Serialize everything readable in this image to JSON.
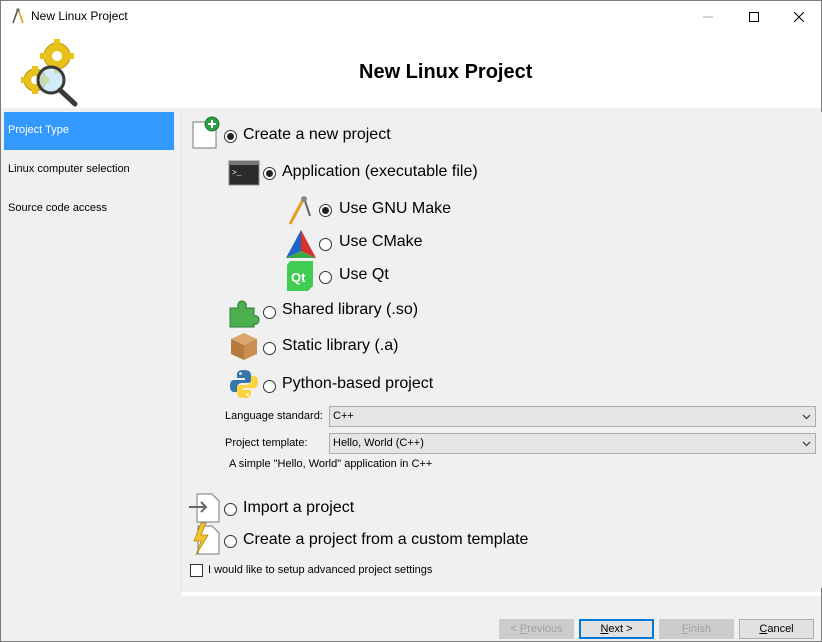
{
  "window": {
    "title": "New Linux Project",
    "controls": {
      "minimize": "minimize",
      "maximize": "maximize",
      "close": "close"
    }
  },
  "header": {
    "heading": "New Linux Project"
  },
  "sidebar": {
    "items": [
      {
        "label": "Project Type",
        "active": true
      },
      {
        "label": "Linux computer selection",
        "active": false
      },
      {
        "label": "Source code access",
        "active": false
      }
    ]
  },
  "options": {
    "create_new": {
      "label": "Create a new project",
      "checked": true
    },
    "application": {
      "label": "Application (executable file)",
      "checked": true
    },
    "gnu_make": {
      "label": "Use GNU Make",
      "checked": true
    },
    "cmake": {
      "label": "Use CMake",
      "checked": false
    },
    "qt": {
      "label": "Use Qt",
      "checked": false
    },
    "shared_library": {
      "label": "Shared library (.so)",
      "checked": false
    },
    "static_library": {
      "label": "Static library (.a)",
      "checked": false
    },
    "python": {
      "label": "Python-based project",
      "checked": false
    },
    "import": {
      "label": "Import a project",
      "checked": false
    },
    "custom_template": {
      "label": "Create a project from a custom template",
      "checked": false
    }
  },
  "fields": {
    "language_standard": {
      "label": "Language standard:",
      "value": "C++"
    },
    "project_template": {
      "label": "Project template:",
      "value": "Hello, World (C++)"
    },
    "template_hint": "A simple \"Hello, World\" application in C++"
  },
  "advanced_settings": {
    "label": "I would like to setup advanced project settings",
    "checked": false
  },
  "buttons": {
    "previous": {
      "prefix": "< ",
      "underline": "P",
      "rest": "revious",
      "enabled": false
    },
    "next": {
      "underline": "N",
      "rest": "ext >",
      "enabled": true
    },
    "finish": {
      "underline": "F",
      "rest": "inish",
      "enabled": false
    },
    "cancel": {
      "underline": "C",
      "rest": "ancel",
      "enabled": true
    }
  },
  "colors": {
    "selected_item": "#3399ff",
    "panel": "#f0f0f0",
    "primary_border": "#0078d7"
  },
  "icons": {
    "app_icon": "compass-icon",
    "logo": "gears-magnifier-icon",
    "new_project": "new-document-icon",
    "application": "terminal-icon",
    "gnu_make": "compass-icon",
    "cmake": "cmake-triangle-icon",
    "qt": "qt-icon",
    "shared_library": "puzzle-icon",
    "static_library": "box-icon",
    "python": "python-icon",
    "import": "import-document-icon",
    "custom_template": "template-bolt-icon"
  }
}
